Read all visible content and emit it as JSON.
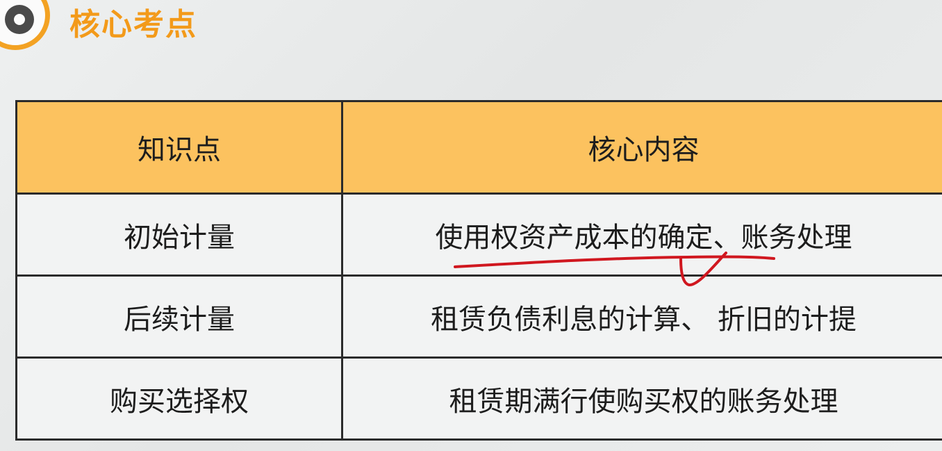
{
  "header": {
    "title": "核心考点",
    "icon": "target-icon",
    "accent_color": "#f3a223"
  },
  "table": {
    "columns": [
      "知识点",
      "核心内容"
    ],
    "rows": [
      {
        "topic": "初始计量",
        "content": "使用权资产成本的确定、账务处理"
      },
      {
        "topic": "后续计量",
        "content": "租赁负债利息的计算、 折旧的计提"
      },
      {
        "topic": "购买选择权",
        "content": "租赁期满行使购买权的账务处理"
      }
    ],
    "header_color": "#fcc25f"
  },
  "annotation": {
    "type": "red-handwritten-underline",
    "color": "#d0171f"
  }
}
